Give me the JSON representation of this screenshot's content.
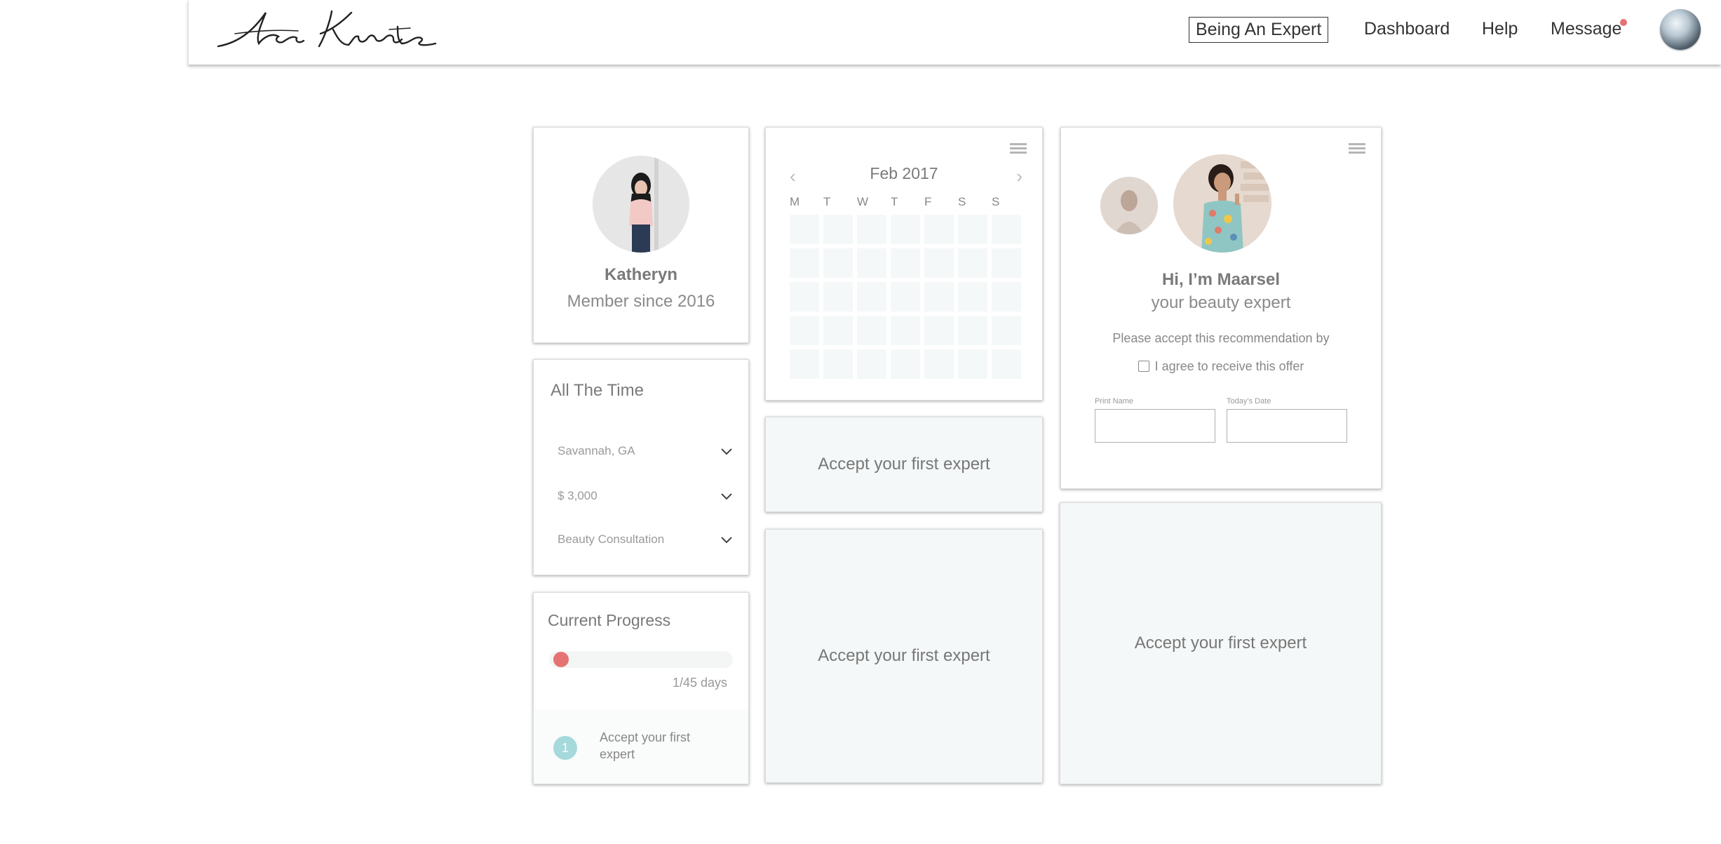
{
  "header": {
    "logo_text": "An Kurate",
    "nav": {
      "being_expert": "Being An Expert",
      "dashboard": "Dashboard",
      "help": "Help",
      "message": "Message"
    }
  },
  "profile": {
    "name": "Katheryn",
    "member_since": "Member since 2016"
  },
  "filters": {
    "title": "All The Time",
    "location": "Savannah, GA",
    "budget": "$ 3,000",
    "service": "Beauty Consultation"
  },
  "progress": {
    "title": "Current Progress",
    "days_text": "1/45 days",
    "progress_fraction": 0.022,
    "step_number": "1",
    "step_text": "Accept your first expert"
  },
  "calendar": {
    "month": "Feb 2017",
    "prev": "‹",
    "next": "›",
    "weekdays": [
      "M",
      "T",
      "W",
      "T",
      "F",
      "S",
      "S"
    ]
  },
  "expert": {
    "greeting": "Hi, I’m Maarsel",
    "role": "your beauty expert",
    "instruction": "Please accept this recommendation by",
    "agree_label": "I agree to receive this offer",
    "print_name_label": "Print Name",
    "date_label": "Today’s Date"
  },
  "placeholders": {
    "small": "Accept your first expert",
    "middle": "Accept your first expert",
    "right": "Accept your first expert"
  },
  "colors": {
    "accent_red": "#e57373",
    "step_teal": "#a6d9dc",
    "placeholder_bg": "#f5f8f8"
  }
}
